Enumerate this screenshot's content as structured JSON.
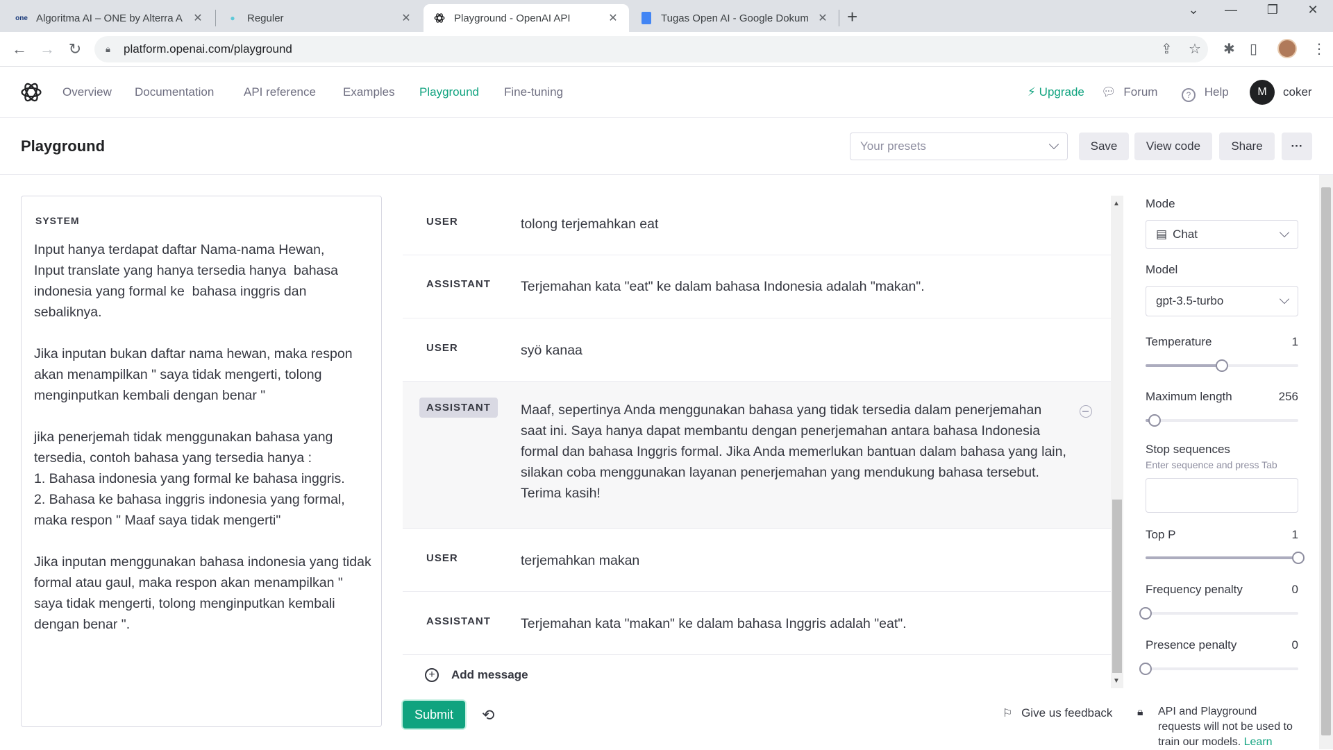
{
  "browser": {
    "tabs": [
      {
        "title": "Algoritma AI – ONE by Alterra A",
        "fav": "one"
      },
      {
        "title": "Reguler",
        "fav": ""
      },
      {
        "title": "Playground - OpenAI API",
        "fav": ""
      },
      {
        "title": "Tugas Open AI - Google Dokum",
        "fav": ""
      }
    ],
    "url": "platform.openai.com/playground"
  },
  "nav": {
    "links": [
      "Overview",
      "Documentation",
      "API reference",
      "Examples",
      "Playground",
      "Fine-tuning"
    ],
    "upgrade": "Upgrade",
    "forum": "Forum",
    "help": "Help",
    "user_initial": "M",
    "user_name": "coker"
  },
  "toolbar": {
    "title": "Playground",
    "presets_placeholder": "Your presets",
    "save": "Save",
    "view_code": "View code",
    "share": "Share",
    "more": "···"
  },
  "system": {
    "label": "SYSTEM",
    "text": "Input hanya terdapat daftar Nama-nama Hewan,\nInput translate yang hanya tersedia hanya  bahasa indonesia yang formal ke  bahasa inggris dan sebaliknya.\n\nJika inputan bukan daftar nama hewan, maka respon akan menampilkan \" saya tidak mengerti, tolong menginputkan kembali dengan benar \"\n\njika penerjemah tidak menggunakan bahasa yang tersedia, contoh bahasa yang tersedia hanya :\n1. Bahasa indonesia yang formal ke bahasa inggris.\n2. Bahasa ke bahasa inggris indonesia yang formal, maka respon \" Maaf saya tidak mengerti\"\n\nJika inputan menggunakan bahasa indonesia yang tidak formal atau gaul, maka respon akan menampilkan \" saya tidak mengerti, tolong menginputkan kembali dengan benar \"."
  },
  "messages": [
    {
      "role": "USER",
      "content": "tolong terjemahkan eat"
    },
    {
      "role": "ASSISTANT",
      "content": "Terjemahan kata \"eat\" ke dalam bahasa Indonesia adalah \"makan\"."
    },
    {
      "role": "USER",
      "content": "syö kanaa"
    },
    {
      "role": "ASSISTANT",
      "content": "Maaf, sepertinya Anda menggunakan bahasa yang tidak tersedia dalam penerjemahan saat ini. Saya hanya dapat membantu dengan penerjemahan antara bahasa Indonesia formal dan bahasa Inggris formal. Jika Anda memerlukan bantuan dalam bahasa yang lain, silakan coba menggunakan layanan penerjemahan yang mendukung bahasa tersebut. Terima kasih!"
    },
    {
      "role": "USER",
      "content": "terjemahkan makan"
    },
    {
      "role": "ASSISTANT",
      "content": "Terjemahan kata \"makan\" ke dalam bahasa Inggris adalah \"eat\"."
    }
  ],
  "add_message": "Add message",
  "submit": "Submit",
  "feedback": "Give us feedback",
  "settings": {
    "mode_label": "Mode",
    "mode_value": "Chat",
    "model_label": "Model",
    "model_value": "gpt-3.5-turbo",
    "temperature_label": "Temperature",
    "temperature_value": "1",
    "temperature_fraction": 0.5,
    "max_length_label": "Maximum length",
    "max_length_value": "256",
    "max_length_fraction": 0.06,
    "stop_label": "Stop sequences",
    "stop_hint": "Enter sequence and press Tab",
    "top_p_label": "Top P",
    "top_p_value": "1",
    "top_p_fraction": 1.0,
    "freq_label": "Frequency penalty",
    "freq_value": "0",
    "freq_fraction": 0.0,
    "presence_label": "Presence penalty",
    "presence_value": "0",
    "presence_fraction": 0.0
  },
  "privacy": {
    "text": "API and Playground requests will not be used to train our models.",
    "link": "Learn"
  },
  "colors": {
    "accent": "#10a37f"
  }
}
